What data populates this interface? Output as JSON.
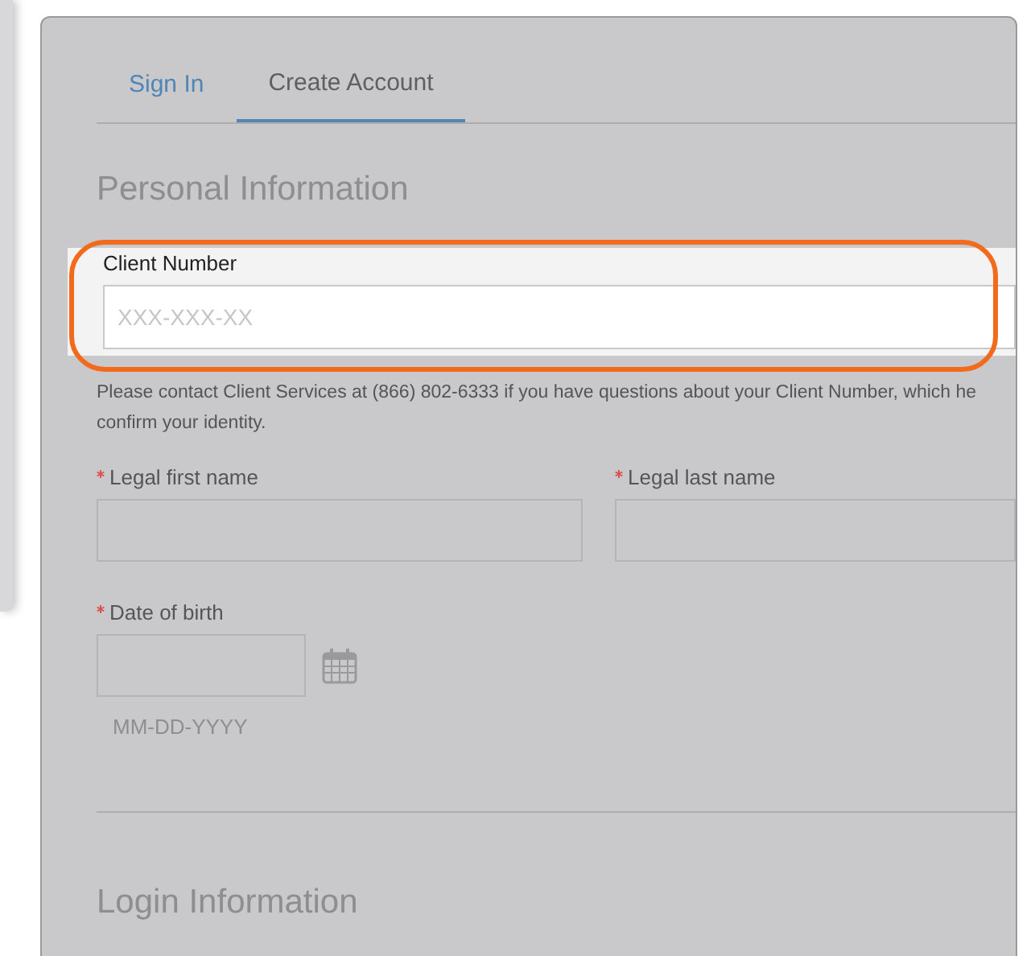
{
  "tabs": [
    {
      "label": "Sign In",
      "selected": false
    },
    {
      "label": "Create Account",
      "selected": true
    }
  ],
  "personal_section": {
    "title": "Personal Information"
  },
  "client_number": {
    "label": "Client Number",
    "placeholder": "XXX-XXX-XX",
    "highlighted": true
  },
  "help_text": [
    "Please contact Client Services at (866) 802-6333 if you have questions about your Client Number, which he",
    "confirm your identity."
  ],
  "name_fields": [
    {
      "label": "Legal first name",
      "required": true
    },
    {
      "label": "Legal last name",
      "required": true
    }
  ],
  "date_of_birth": {
    "label": "Date of birth",
    "required": true,
    "hint": "MM-DD-YYYY"
  },
  "login_section": {
    "title": "Login Information"
  }
}
